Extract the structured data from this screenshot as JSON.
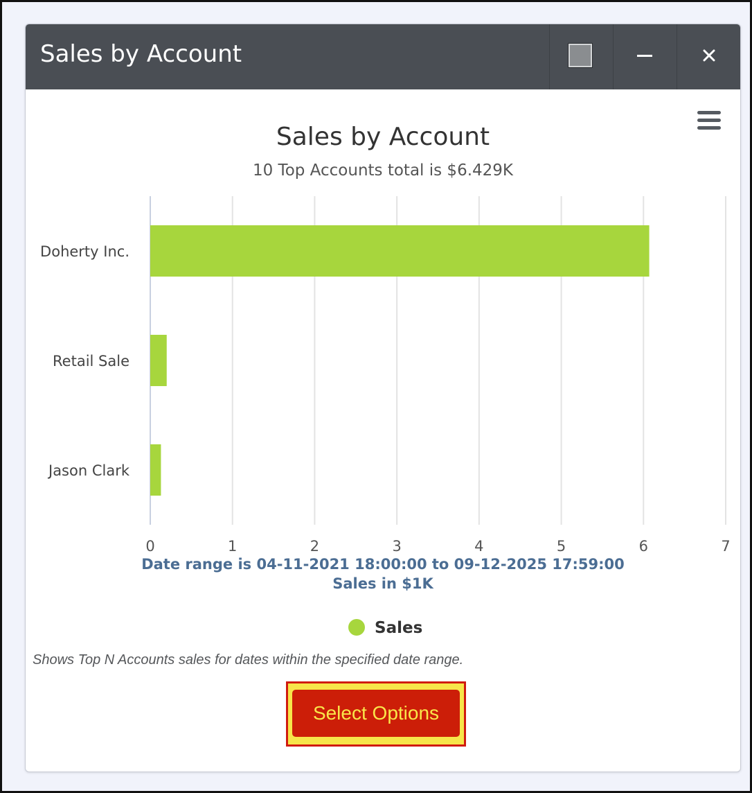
{
  "window": {
    "title": "Sales by Account",
    "controls": {
      "maximize_icon": "square-icon",
      "minimize_icon": "minus-icon",
      "close_icon": "close-icon"
    },
    "menu_icon": "hamburger-icon"
  },
  "chart_data": {
    "type": "bar",
    "orientation": "horizontal",
    "title": "Sales by Account",
    "subtitle": "10 Top Accounts total is $6.429K",
    "categories": [
      "Doherty Inc.",
      "Retail Sale",
      "Jason Clark"
    ],
    "series": [
      {
        "name": "Sales",
        "values": [
          6.07,
          0.2,
          0.13
        ],
        "color": "#a7d63d"
      }
    ],
    "xlabel_lines": [
      "Date range is 04-11-2021 18:00:00 to 09-12-2025 17:59:00",
      "Sales in $1K"
    ],
    "xlim": [
      0,
      7
    ],
    "xticks": [
      "0",
      "1",
      "2",
      "3",
      "4",
      "5",
      "6",
      "7"
    ],
    "grid": true,
    "legend": "bottom-center",
    "colors": {
      "bar": "#a7d63d",
      "axis_label": "#4b6d93",
      "text": "#333333"
    }
  },
  "caption": "Shows Top N Accounts sales for dates within the specified date range.",
  "select_button": {
    "label": "Select Options"
  }
}
